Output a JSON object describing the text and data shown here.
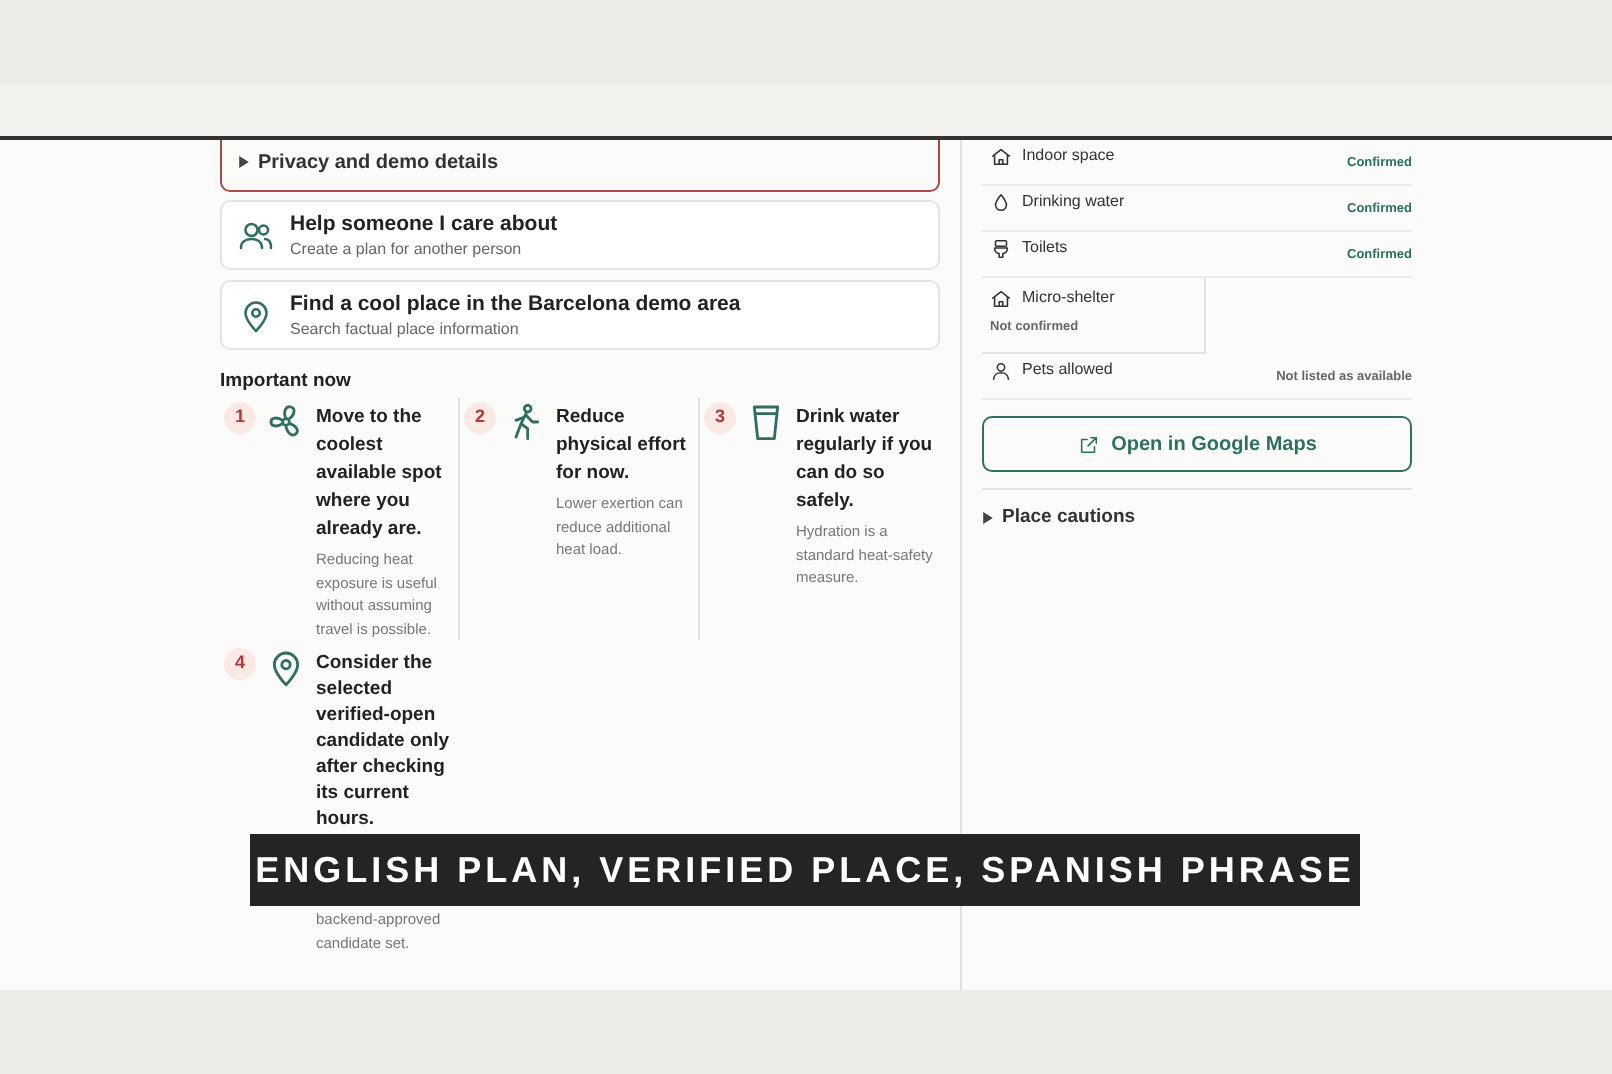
{
  "privacy": {
    "label": "Privacy and demo details",
    "expanded": false
  },
  "actions": [
    {
      "kind": "people",
      "title": "Help someone I care about",
      "subtitle": "Create a plan for another person"
    },
    {
      "kind": "pin",
      "title": "Find a cool place in the Barcelona demo area",
      "subtitle": "Search factual place information"
    }
  ],
  "important": {
    "title": "Important now",
    "steps": [
      {
        "number": "1",
        "kind": "fan",
        "heading": "Move to the coolest available spot where you already are.",
        "detail": "Reducing heat exposure is useful without assuming travel is possible."
      },
      {
        "number": "2",
        "kind": "walk",
        "heading": "Reduce physical effort for now.",
        "detail": "Lower exertion can reduce additional heat load."
      },
      {
        "number": "3",
        "kind": "cup",
        "heading": "Drink water regularly if you can do so safely.",
        "detail": "Hydration is a standard heat-safety measure."
      },
      {
        "number": "4",
        "kind": "pin",
        "heading": "Consider the selected verified-open candidate only after checking its current hours.",
        "detail": "backend-approved candidate set."
      }
    ]
  },
  "amenities": [
    {
      "kind": "house",
      "label": "Indoor space",
      "status": "Confirmed",
      "confirmed": true,
      "highlighted": false
    },
    {
      "kind": "drop",
      "label": "Drinking water",
      "status": "Confirmed",
      "confirmed": true,
      "highlighted": false
    },
    {
      "kind": "toilet",
      "label": "Toilets",
      "status": "Confirmed",
      "confirmed": true,
      "highlighted": false
    },
    {
      "kind": "house",
      "label": "Micro-shelter",
      "status": "Not confirmed",
      "confirmed": false,
      "highlighted": true
    },
    {
      "kind": "person",
      "label": "Pets allowed",
      "status": "Not listed as available",
      "confirmed": false,
      "highlighted": false
    }
  ],
  "maps_button": "Open in Google Maps",
  "cautions": {
    "label": "Place cautions",
    "expanded": false
  },
  "caption": "ENGLISH PLAN, VERIFIED PLACE, SPANISH PHRASE"
}
